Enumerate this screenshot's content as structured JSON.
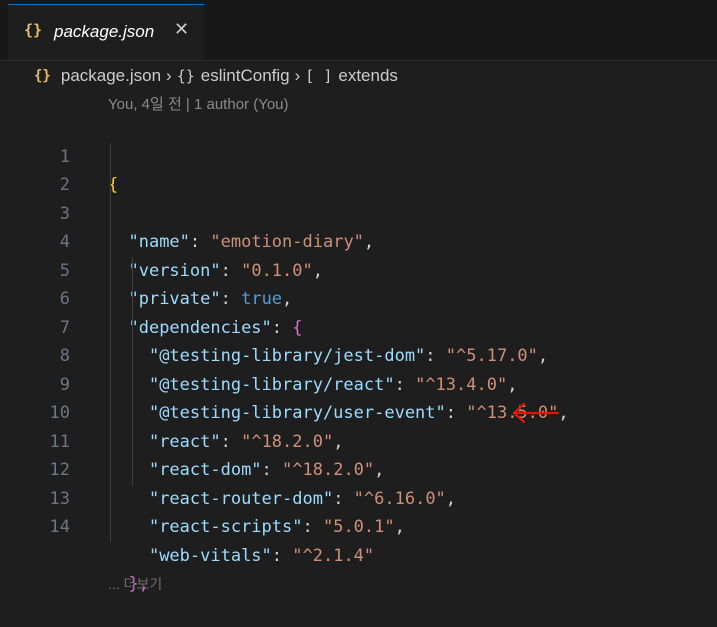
{
  "tab": {
    "icon": "{}",
    "name": "package.json",
    "close": "✕"
  },
  "breadcrumb": {
    "file_icon": "{}",
    "file": "package.json",
    "sep": "›",
    "obj_icon": "{}",
    "obj": "eslintConfig",
    "arr_icon": "[ ]",
    "arr": "extends"
  },
  "codelens": "You, 4일 전 | 1 author (You)",
  "lines": [
    {
      "n": "1",
      "brace": "{"
    },
    {
      "n": "2",
      "key": "\"name\"",
      "value": "\"emotion-diary\""
    },
    {
      "n": "3",
      "key": "\"version\"",
      "value": "\"0.1.0\""
    },
    {
      "n": "4",
      "key": "\"private\"",
      "value": "true"
    },
    {
      "n": "5",
      "key": "\"dependencies\"",
      "brace": "{"
    },
    {
      "n": "6",
      "key": "\"@testing-library/jest-dom\"",
      "value": "\"^5.17.0\""
    },
    {
      "n": "7",
      "key": "\"@testing-library/react\"",
      "value": "\"^13.4.0\""
    },
    {
      "n": "8",
      "key": "\"@testing-library/user-event\"",
      "value": "\"^13.5.0\""
    },
    {
      "n": "9",
      "key": "\"react\"",
      "value": "\"^18.2.0\""
    },
    {
      "n": "10",
      "key": "\"react-dom\"",
      "value": "\"^18.2.0\""
    },
    {
      "n": "11",
      "key": "\"react-router-dom\"",
      "value": "\"^6.16.0\""
    },
    {
      "n": "12",
      "key": "\"react-scripts\"",
      "value": "\"5.0.1\""
    },
    {
      "n": "13",
      "key": "\"web-vitals\"",
      "value": "\"^2.1.4\""
    },
    {
      "n": "14",
      "brace": "},"
    }
  ],
  "partial_codelens": "... 더보기",
  "annotation_color": "#e51400"
}
